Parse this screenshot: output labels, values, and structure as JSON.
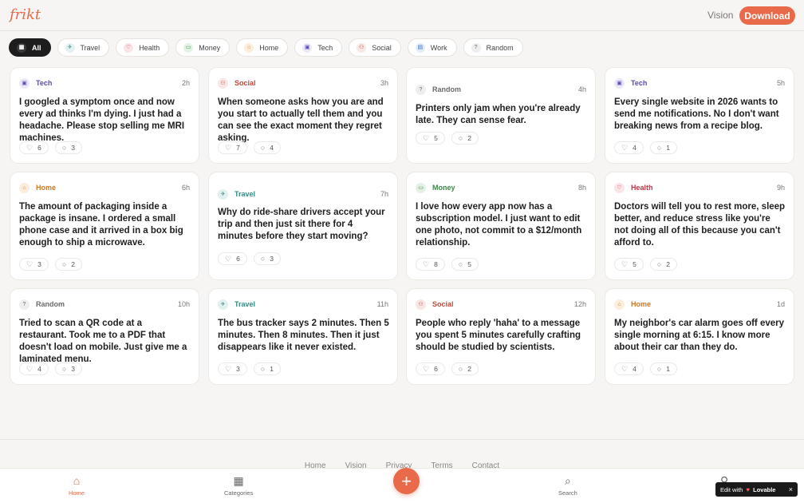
{
  "header": {
    "logo": "frikt",
    "nav_vision": "Vision",
    "download_label": "Download"
  },
  "filters": [
    {
      "label": "All",
      "icon": "grid-icon",
      "active": true
    },
    {
      "label": "Travel",
      "icon": "plane-icon"
    },
    {
      "label": "Health",
      "icon": "heart-icon"
    },
    {
      "label": "Money",
      "icon": "money-icon"
    },
    {
      "label": "Home",
      "icon": "house-icon"
    },
    {
      "label": "Tech",
      "icon": "chip-icon"
    },
    {
      "label": "Social",
      "icon": "people-icon"
    },
    {
      "label": "Work",
      "icon": "briefcase-icon"
    },
    {
      "label": "Random",
      "icon": "question-icon"
    }
  ],
  "category_colors": {
    "Tech": "#5b4bb5",
    "Social": "#c0493b",
    "Random": "#6a6a6a",
    "Home": "#c9792c",
    "Travel": "#2f8c86",
    "Money": "#3d8a46",
    "Health": "#c0394b",
    "Work": "#3b6fc0",
    "All": "#ffffff"
  },
  "category_bg": {
    "Tech": "#ebe8f7",
    "Social": "#f8e7e4",
    "Random": "#eeeeee",
    "Home": "#fbeedd",
    "Travel": "#e2f1ef",
    "Money": "#e4f2e5",
    "Health": "#f9e4e7",
    "Work": "#e4ecf8",
    "All": "#3a3a3a"
  },
  "category_icon_glyphs": {
    "Tech": "▣",
    "Social": "⚇",
    "Random": "?",
    "Home": "⌂",
    "Travel": "✈",
    "Money": "▭",
    "Health": "♡",
    "Work": "▤",
    "All": "▦"
  },
  "posts": [
    {
      "category": "Tech",
      "time": "2h",
      "text": "I googled a symptom once and now every ad thinks I'm dying. I just had a headache. Please stop selling me MRI machines.",
      "likes": "6",
      "comments": "3"
    },
    {
      "category": "Social",
      "time": "3h",
      "text": "When someone asks how you are and you start to actually tell them and you can see the exact moment they regret asking.",
      "likes": "7",
      "comments": "4"
    },
    {
      "category": "Random",
      "time": "4h",
      "text": "Printers only jam when you're already late. They can sense fear.",
      "likes": "5",
      "comments": "2"
    },
    {
      "category": "Tech",
      "time": "5h",
      "text": "Every single website in 2026 wants to send me notifications. No I don't want breaking news from a recipe blog.",
      "likes": "4",
      "comments": "1"
    },
    {
      "category": "Home",
      "time": "6h",
      "text": "The amount of packaging inside a package is insane. I ordered a small phone case and it arrived in a box big enough to ship a microwave.",
      "likes": "3",
      "comments": "2"
    },
    {
      "category": "Travel",
      "time": "7h",
      "text": "Why do ride-share drivers accept your trip and then just sit there for 4 minutes before they start moving?",
      "likes": "6",
      "comments": "3"
    },
    {
      "category": "Money",
      "time": "8h",
      "text": "I love how every app now has a subscription model. I just want to edit one photo, not commit to a $12/month relationship.",
      "likes": "8",
      "comments": "5"
    },
    {
      "category": "Health",
      "time": "9h",
      "text": "Doctors will tell you to rest more, sleep better, and reduce stress like you're not doing all of this because you can't afford to.",
      "likes": "5",
      "comments": "2"
    },
    {
      "category": "Random",
      "time": "10h",
      "text": "Tried to scan a QR code at a restaurant. Took me to a PDF that doesn't load on mobile. Just give me a laminated menu.",
      "likes": "4",
      "comments": "3"
    },
    {
      "category": "Travel",
      "time": "11h",
      "text": "The bus tracker says 2 minutes. Then 5 minutes. Then 8 minutes. Then it just disappears like it never existed.",
      "likes": "3",
      "comments": "1"
    },
    {
      "category": "Social",
      "time": "12h",
      "text": "People who reply 'haha' to a message you spent 5 minutes carefully crafting should be studied by scientists.",
      "likes": "6",
      "comments": "2"
    },
    {
      "category": "Home",
      "time": "1d",
      "text": "My neighbor's car alarm goes off every single morning at 6:15. I know more about their car than they do.",
      "likes": "4",
      "comments": "1"
    }
  ],
  "footer_links": [
    "Home",
    "Vision",
    "Privacy",
    "Terms",
    "Contact"
  ],
  "bottom_nav": {
    "home": {
      "label": "Home",
      "icon": "house-icon"
    },
    "categories": {
      "label": "Categories",
      "icon": "grid-icon"
    },
    "add": {
      "label": "+",
      "icon": "plus-icon"
    },
    "search": {
      "label": "Search",
      "icon": "search-icon"
    },
    "profile": {
      "label": "",
      "icon": "user-icon"
    }
  },
  "lovable_badge": {
    "prefix": "Edit with",
    "brand": "Lovable",
    "close": "×"
  }
}
